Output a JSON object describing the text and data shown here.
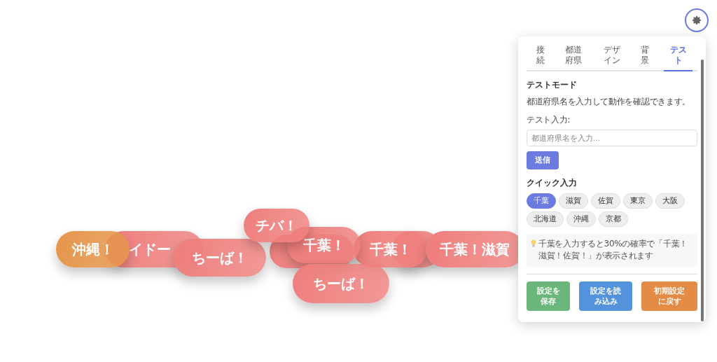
{
  "bubbles": [
    {
      "text": "沖縄！",
      "color": "#e5954a"
    },
    {
      "text": "イドー",
      "color": "#ee7f7d"
    },
    {
      "text": "ちーば！",
      "color": "#ee7f7d"
    },
    {
      "text": "チバ！",
      "color": "#ee7f7d"
    },
    {
      "color": "#ee7f7d"
    },
    {
      "text": "千葉！",
      "color": "#ee7f7d"
    },
    {
      "text": "ちーば！",
      "color": "#ee7f7d"
    },
    {
      "text": "千葉！",
      "color": "#ee7f7d"
    },
    {
      "color": "#ee7f7d"
    },
    {
      "text": "千葉！滋賀",
      "color": "#ee7f7d"
    }
  ],
  "tabs": [
    {
      "label": "接続",
      "selected": false
    },
    {
      "label": "都道府県",
      "selected": false
    },
    {
      "label": "デザイン",
      "selected": false
    },
    {
      "label": "背景",
      "selected": false
    },
    {
      "label": "テスト",
      "selected": true
    }
  ],
  "section_title": "テストモード",
  "description": "都道府県名を入力して動作を確認できます。",
  "input_label": "テスト入力:",
  "input": {
    "placeholder": "都道府県名を入力..."
  },
  "submit_button": "送信",
  "quick_title": "クイック入力",
  "chips": [
    {
      "label": "千葉",
      "selected": true
    },
    {
      "label": "滋賀",
      "selected": false
    },
    {
      "label": "佐賀",
      "selected": false
    },
    {
      "label": "東京",
      "selected": false
    },
    {
      "label": "大阪",
      "selected": false
    },
    {
      "label": "北海道",
      "selected": false
    },
    {
      "label": "沖縄",
      "selected": false
    },
    {
      "label": "京都",
      "selected": false
    }
  ],
  "tip": "千葉を入力すると30%の確率で「千葉！滋賀！佐賀！」が表示されます",
  "actions": [
    {
      "label": "設定を保存",
      "kind": "save"
    },
    {
      "label": "設定を読み込み",
      "kind": "load"
    },
    {
      "label": "初期設定に戻す",
      "kind": "reset"
    }
  ]
}
